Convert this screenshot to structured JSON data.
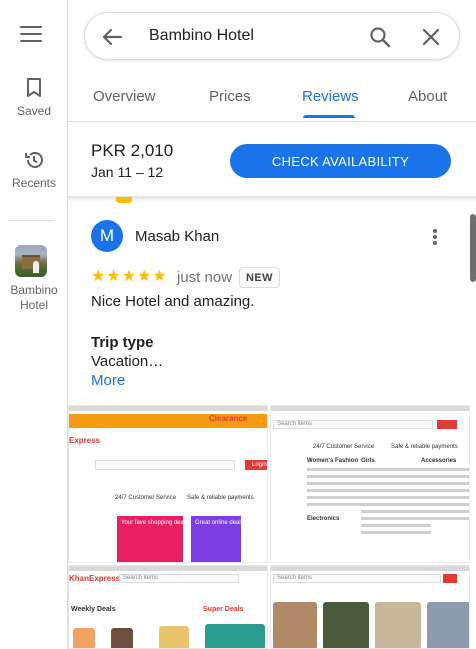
{
  "rail": {
    "saved_label": "Saved",
    "recents_label": "Recents",
    "place_label": "Bambino Hotel"
  },
  "search": {
    "query": "Bambino Hotel"
  },
  "tabs": [
    {
      "label": "Overview"
    },
    {
      "label": "Prices"
    },
    {
      "label": "Reviews"
    },
    {
      "label": "About"
    }
  ],
  "active_tab": "Reviews",
  "price_bar": {
    "price": "PKR 2,010",
    "dates": "Jan 11 – 12",
    "cta_label": "CHECK AVAILABILITY"
  },
  "review": {
    "avatar_initial": "M",
    "reviewer": "Masab Khan",
    "rating_stars": "★★★★★",
    "rating": 5,
    "time": "just now",
    "badge": "NEW",
    "text": "Nice Hotel and amazing.",
    "trip_type_heading": "Trip type",
    "trip_type_value": "Vacation…",
    "more_label": "More"
  },
  "photos": {
    "items": [
      {
        "caption": "Express",
        "text2": "Clearance",
        "text3": "24/7 Customer Service",
        "text4": "Safe & reliable payments",
        "text5": "Login",
        "text6": "Your fave shopping deals",
        "text7": "Great online deals"
      },
      {
        "caption": "Search items",
        "text2": "24/7 Customer Service",
        "text3": "Safe & reliable payments",
        "text4": "Women's Fashion",
        "text5": "Girls",
        "text6": "Accessories",
        "text7": "Electronics"
      },
      {
        "caption": "KhanExpress",
        "text2": "Search items",
        "text3": "Weekly Deals",
        "text4": "Super Deals"
      },
      {
        "caption": "Search items"
      }
    ]
  },
  "colors": {
    "accent": "#1a73e8",
    "star": "#fbbc04",
    "text_secondary": "#5f6368"
  }
}
